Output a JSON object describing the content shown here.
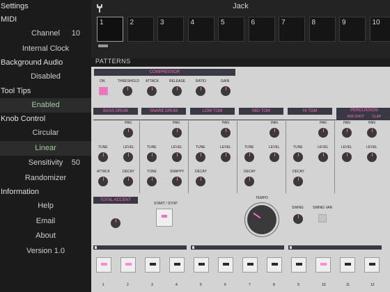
{
  "sidebar": {
    "settings": "Settings",
    "midi": "MIDI",
    "channel_label": "Channel",
    "channel_value": "10",
    "internal_clock": "Internal Clock",
    "background_audio": "Background Audio",
    "disabled": "Disabled",
    "tool_tips": "Tool Tips",
    "enabled": "Enabled",
    "knob_control": "Knob Control",
    "circular": "Circular",
    "linear": "Linear",
    "sensitivity_label": "Sensitivity",
    "sensitivity_value": "50",
    "randomizer": "Randomizer",
    "information": "Information",
    "help": "Help",
    "email": "Email",
    "about": "About",
    "version": "Version 1.0"
  },
  "topbar": {
    "title": "Jack",
    "patterns": [
      "1",
      "2",
      "3",
      "4",
      "5",
      "6",
      "7",
      "8",
      "9",
      "10"
    ]
  },
  "patterns_label": "PATTERNS",
  "compressor": {
    "title": "COMPRESSOR",
    "on": "ON",
    "threshold": "THRESHOLD",
    "attack": "ATTACK",
    "release": "RELEASE",
    "ratio": "RATIO",
    "gain": "GAIN"
  },
  "channels": {
    "bass_drum": "BASS DRUM",
    "snare_drum": "SNARE DRUM",
    "low_tom": "LOW TOM",
    "mid_tom": "MID TOM",
    "hi_tom": "HI TOM",
    "percussion": "PERCUSSION",
    "rim_shot": "RIM SHOT",
    "clap": "CLAP"
  },
  "knob_labels": {
    "pan": "PAN",
    "tune": "TUNE",
    "level": "LEVEL",
    "attack": "ATTACK",
    "decay": "DECAY",
    "tone": "TONE",
    "snappy": "SNAPPY"
  },
  "master": {
    "total_accent": "TOTAL ACCENT",
    "start_stop": "START / STOP",
    "tempo": "TEMPO",
    "swing": "SWING",
    "swing_var": "SWING VAR"
  },
  "steps": [
    "1",
    "2",
    "3",
    "4",
    "5",
    "6",
    "7",
    "8",
    "9",
    "10",
    "11",
    "12"
  ],
  "colors": {
    "accent": "#ff69c6",
    "header": "#393943",
    "panel": "#d3d3d3",
    "enabled": "#9ed09a"
  }
}
